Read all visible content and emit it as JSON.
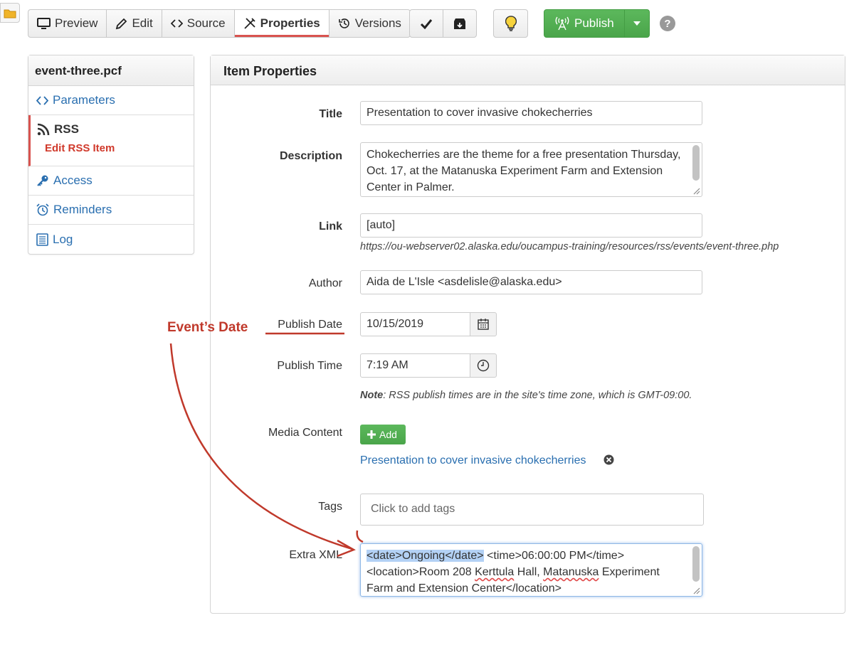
{
  "toolbar": {
    "view_tabs": [
      {
        "label": "Preview",
        "icon": "monitor-icon"
      },
      {
        "label": "Edit",
        "icon": "pencil-icon"
      },
      {
        "label": "Source",
        "icon": "code-icon"
      },
      {
        "label": "Properties",
        "icon": "tools-icon",
        "active": true
      },
      {
        "label": "Versions",
        "icon": "history-icon"
      }
    ],
    "publish_label": "Publish",
    "help_label": "?"
  },
  "sidebar": {
    "file_name": "event-three.pcf",
    "items": {
      "parameters": "Parameters",
      "rss": "RSS",
      "rss_sub": "Edit RSS Item",
      "access": "Access",
      "reminders": "Reminders",
      "log": "Log"
    }
  },
  "panel": {
    "title": "Item Properties",
    "title_label": "Title",
    "title_value": "Presentation to cover invasive chokecherries",
    "description_label": "Description",
    "description_value": "Chokecherries are the theme for a free presentation Thursday, Oct. 17, at the Matanuska Experiment Farm and Extension Center in Palmer.",
    "link_label": "Link",
    "link_value": "[auto]",
    "link_url": "https://ou-webserver02.alaska.edu/oucampus-training/resources/rss/events/event-three.php",
    "author_label": "Author",
    "author_value": "Aida de L'Isle <asdelisle@alaska.edu>",
    "publish_date_label": "Publish Date",
    "publish_date_value": "10/15/2019",
    "publish_time_label": "Publish Time",
    "publish_time_value": "7:19 AM",
    "note_prefix": "Note",
    "note_text": ": RSS publish times are in the site's time zone, which is GMT-09:00.",
    "media_label": "Media Content",
    "add_label": "Add",
    "media_item": "Presentation to cover invasive chokecherries",
    "tags_label": "Tags",
    "tags_placeholder": "Click to add tags",
    "extra_xml_label": "Extra XML",
    "extra_xml": {
      "selected": "<date>Ongoing</date>",
      "part1": " <time>06:00:00 PM</time>",
      "part2": "<location>Room 208 ",
      "kerttula": "Kerttula",
      "part3": " Hall, ",
      "matanuska": "Matanuska",
      "part4": " Experiment",
      "line3": "Farm and Extension Center</location>"
    }
  },
  "annotation": {
    "label": "Event’s Date",
    "color": "#c0392b"
  },
  "colors": {
    "link": "#2a6fb0",
    "publish_green": "#5cb85c",
    "active_accent": "#d9534f",
    "selection": "#b3d1f5"
  }
}
